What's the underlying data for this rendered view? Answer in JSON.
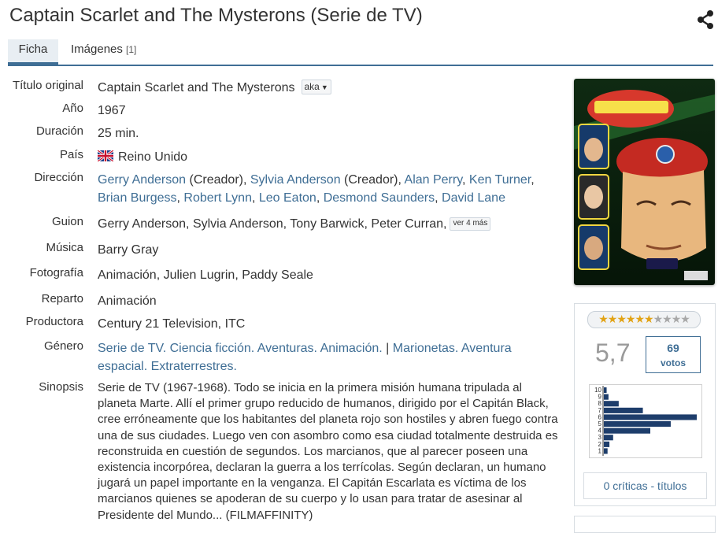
{
  "page": {
    "title": "Captain Scarlet and The Mysterons (Serie de TV)"
  },
  "tabs": [
    {
      "label": "Ficha"
    },
    {
      "label": "Imágenes",
      "count": "[1]"
    }
  ],
  "fields": {
    "original_title": {
      "label": "Título original",
      "value": "Captain Scarlet and The Mysterons",
      "aka": "aka"
    },
    "year": {
      "label": "Año",
      "value": "1967"
    },
    "duration": {
      "label": "Duración",
      "value": "25 min."
    },
    "country": {
      "label": "País",
      "value": "Reino Unido"
    },
    "direction": {
      "label": "Dirección",
      "people": [
        {
          "name": "Gerry Anderson",
          "note": " (Creador), "
        },
        {
          "name": "Sylvia Anderson",
          "note": " (Creador), "
        },
        {
          "name": "Alan Perry",
          "note": ", "
        },
        {
          "name": "Ken Turner",
          "note": ", "
        },
        {
          "name": "Brian Burgess",
          "note": ", "
        },
        {
          "name": "Robert Lynn",
          "note": ", "
        },
        {
          "name": "Leo Eaton",
          "note": ", "
        },
        {
          "name": "Desmond Saunders",
          "note": ", "
        },
        {
          "name": "David Lane",
          "note": ""
        }
      ]
    },
    "script": {
      "label": "Guion",
      "value": "Gerry Anderson, Sylvia Anderson, Tony Barwick, Peter Curran,",
      "more": "ver 4 más"
    },
    "music": {
      "label": "Música",
      "value": "Barry Gray"
    },
    "photography": {
      "label": "Fotografía",
      "value": "Animación, Julien Lugrin, Paddy Seale"
    },
    "cast": {
      "label": "Reparto",
      "value": "Animación"
    },
    "producer": {
      "label": "Productora",
      "value": "Century 21 Television, ITC"
    },
    "genre": {
      "label": "Género",
      "group1": [
        "Serie de TV",
        "Ciencia ficción",
        "Aventuras",
        "Animación"
      ],
      "separator": "|",
      "group2": [
        "Marionetas",
        "Aventura espacial",
        "Extraterrestres"
      ]
    },
    "synopsis": {
      "label": "Sinopsis",
      "value": "Serie de TV (1967-1968). Todo se inicia en la primera misión humana tripulada al planeta Marte. Allí el primer grupo reducido de humanos, dirigido por el Capitán Black, cree erróneamente que los habitantes del planeta rojo son hostiles y abren fuego contra una de sus ciudades. Luego ven con asombro como esa ciudad totalmente destruida es reconstruida en cuestión de segundos. Los marcianos, que al parecer poseen una existencia incorpórea, declaran la guerra a los terrícolas. Según declaran, un humano jugará un papel importante en la venganza. El Capitán Escarlata es víctima de los marcianos quienes se apoderan de su cuerpo y lo usan para tratar de asesinar al Presidente del Mundo... (FILMAFFINITY)"
    }
  },
  "rating": {
    "stars_on": 6,
    "stars_total": 10,
    "average": "5,7",
    "votes": "69",
    "votes_label": "votos",
    "histogram": {
      "labels": [
        "10",
        "9",
        "8",
        "7",
        "6",
        "5",
        "4",
        "3",
        "2",
        "1"
      ],
      "fractions": [
        0.03,
        0.05,
        0.16,
        0.42,
        1.0,
        0.72,
        0.5,
        0.1,
        0.06,
        0.04
      ]
    },
    "critics_label": "0 críticas - títulos"
  },
  "icons": {
    "share": "share-icon",
    "flag": "uk-flag-icon"
  },
  "colors": {
    "accent": "#3f6e95",
    "star_on": "#e2a315",
    "star_off": "#a8a8a8",
    "hist_bar": "#1d3d6b"
  }
}
